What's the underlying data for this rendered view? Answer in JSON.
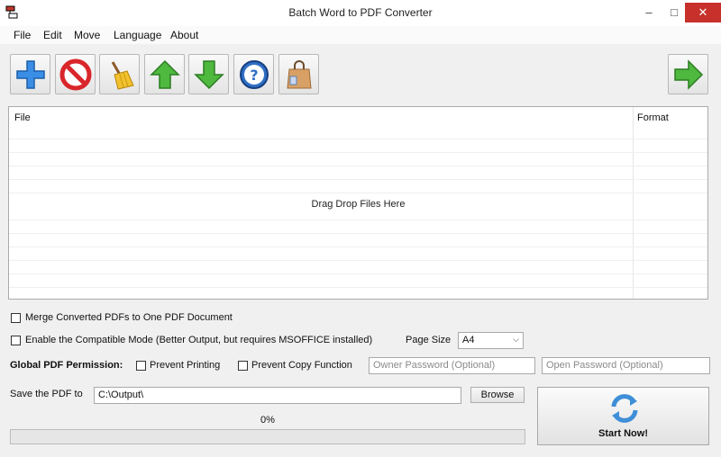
{
  "window": {
    "title": "Batch Word to PDF Converter",
    "minimize_glyph": "–",
    "maximize_glyph": "□",
    "close_glyph": "✕"
  },
  "menu": {
    "items": [
      "File",
      "Edit",
      "Move",
      "Language",
      "About"
    ]
  },
  "toolbar": {
    "buttons": [
      "add-icon",
      "remove-icon",
      "clear-broom-icon",
      "move-up-icon",
      "move-down-icon",
      "help-icon",
      "buy-bag-icon"
    ],
    "next_button": "next-arrow-icon"
  },
  "file_list": {
    "columns": [
      "File",
      "Format"
    ],
    "drop_hint": "Drag  Drop Files Here",
    "rows": []
  },
  "options": {
    "merge_label": "Merge Converted PDFs to One PDF Document",
    "merge_checked": false,
    "compatible_label": "Enable the Compatible Mode (Better Output, but requires MSOFFICE installed)",
    "compatible_checked": false,
    "page_size_label": "Page Size",
    "page_size_value": "A4",
    "permission_label": "Global PDF Permission:",
    "prevent_printing_label": "Prevent Printing",
    "prevent_printing_checked": false,
    "prevent_copy_label": "Prevent Copy Function",
    "prevent_copy_checked": false,
    "owner_password_placeholder": "Owner Password (Optional)",
    "open_password_placeholder": "Open Password (Optional)"
  },
  "output": {
    "save_label": "Save the PDF to",
    "save_path": "C:\\Output\\",
    "browse_label": "Browse"
  },
  "progress": {
    "percent_text": "0%",
    "value": 0
  },
  "start": {
    "label": "Start Now!"
  },
  "colors": {
    "close_red": "#c7302b",
    "arrow_green": "#3fa535",
    "add_blue": "#2f7fd6",
    "remove_red": "#d9262b"
  }
}
